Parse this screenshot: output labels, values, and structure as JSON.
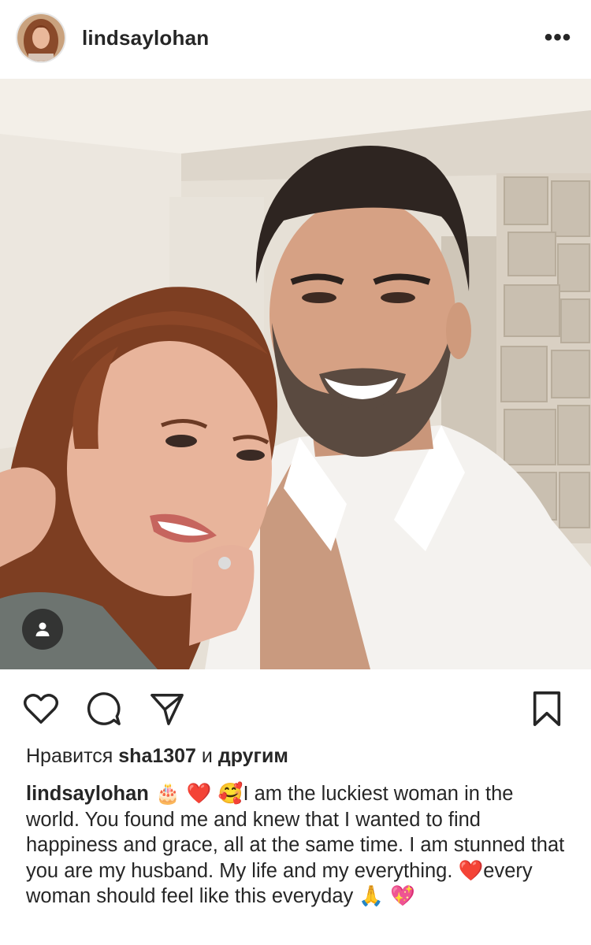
{
  "post": {
    "username": "lindsaylohan",
    "more_icon": "more-horizontal-icon",
    "more_glyph": "•••"
  },
  "photo": {
    "tag_icon": "user-tag-icon"
  },
  "actions": {
    "like_icon": "heart-icon",
    "comment_icon": "comment-icon",
    "share_icon": "send-icon",
    "save_icon": "bookmark-icon"
  },
  "likes": {
    "prefix": "Нравится ",
    "user": "sha1307",
    "middle": " и ",
    "suffix": "другим"
  },
  "caption": {
    "username": "lindsaylohan",
    "emoji_lead": " 🎂 ❤️ 🥰",
    "text1": "I am the luckiest woman in the world. You found me and knew that I wanted to find happiness and grace, all at the same time. I am stunned that you are my husband. My life and my everything. ",
    "emoji_mid": "❤️",
    "text2": "every woman should feel like this everyday ",
    "emoji_end": "🙏 💖"
  },
  "colors": {
    "text": "#262626",
    "background": "#ffffff",
    "tag_badge": "#262626"
  }
}
